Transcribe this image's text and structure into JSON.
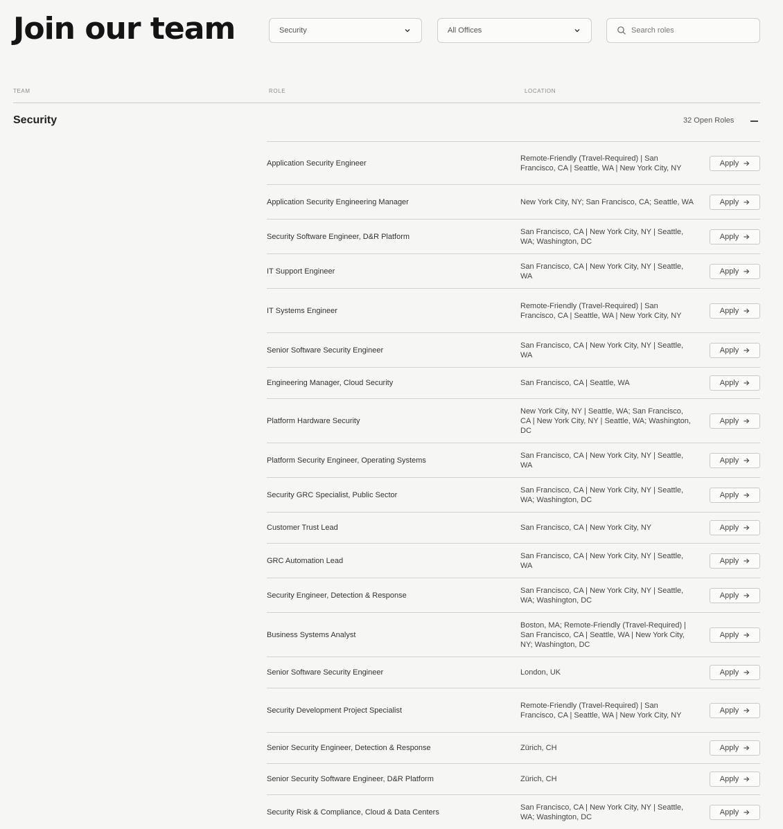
{
  "page": {
    "title": "Join our team"
  },
  "filters": {
    "team": "Security",
    "office": "All Offices",
    "search_placeholder": "Search roles"
  },
  "table": {
    "headers": {
      "team": "TEAM",
      "role": "ROLE",
      "location": "LOCATION"
    },
    "team_name": "Security",
    "open_roles": "32 Open Roles",
    "apply_label": "Apply",
    "rows": [
      {
        "role": "Application Security Engineer",
        "location": "Remote-Friendly (Travel-Required) | San Francisco, CA | Seattle, WA | New York City, NY"
      },
      {
        "role": "Application Security Engineering Manager",
        "location": "New York City, NY; San Francisco, CA; Seattle, WA"
      },
      {
        "role": "Security Software Engineer, D&R Platform",
        "location": "San Francisco, CA | New York City, NY | Seattle, WA; Washington, DC"
      },
      {
        "role": "IT Support Engineer",
        "location": "San Francisco, CA | New York City, NY | Seattle, WA"
      },
      {
        "role": "IT Systems Engineer",
        "location": "Remote-Friendly (Travel-Required) | San Francisco, CA | Seattle, WA | New York City, NY"
      },
      {
        "role": "Senior Software Security Engineer",
        "location": "San Francisco, CA | New York City, NY | Seattle, WA"
      },
      {
        "role": "Engineering Manager, Cloud Security",
        "location": "San Francisco, CA | Seattle, WA"
      },
      {
        "role": "Platform Hardware Security",
        "location": "New York City, NY | Seattle, WA; San Francisco, CA | New York City, NY | Seattle, WA; Washington, DC"
      },
      {
        "role": "Platform Security Engineer, Operating Systems",
        "location": "San Francisco, CA | New York City, NY | Seattle, WA"
      },
      {
        "role": "Security GRC Specialist, Public Sector",
        "location": "San Francisco, CA | New York City, NY | Seattle, WA; Washington, DC"
      },
      {
        "role": "Customer Trust Lead",
        "location": "San Francisco, CA | New York City, NY"
      },
      {
        "role": "GRC Automation Lead",
        "location": "San Francisco, CA | New York City, NY | Seattle, WA"
      },
      {
        "role": "Security Engineer, Detection & Response",
        "location": "San Francisco, CA | New York City, NY | Seattle, WA; Washington, DC"
      },
      {
        "role": "Business Systems Analyst",
        "location": "Boston, MA; Remote-Friendly (Travel-Required) | San Francisco, CA | Seattle, WA | New York City, NY; Washington, DC"
      },
      {
        "role": "Senior Software Security Engineer",
        "location": "London, UK"
      },
      {
        "role": "Security Development Project Specialist",
        "location": "Remote-Friendly (Travel-Required) | San Francisco, CA | Seattle, WA | New York City, NY"
      },
      {
        "role": "Senior Security Engineer, Detection & Response",
        "location": "Zürich, CH"
      },
      {
        "role": "Senior Security Software Engineer, D&R Platform",
        "location": "Zürich, CH"
      },
      {
        "role": "Security Risk & Compliance, Cloud & Data Centers",
        "location": "San Francisco, CA | New York City, NY | Seattle, WA; Washington, DC"
      }
    ]
  }
}
